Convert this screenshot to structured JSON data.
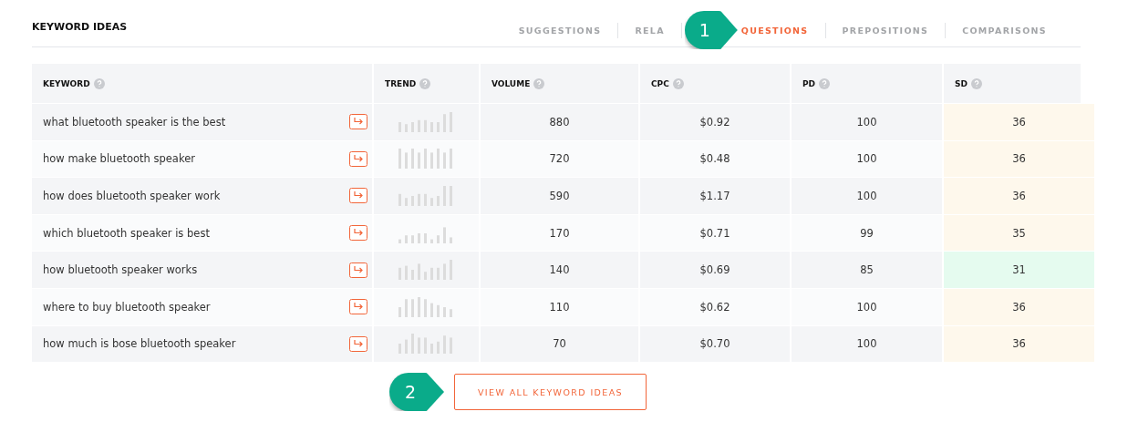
{
  "title": "KEYWORD IDEAS",
  "tabs": [
    {
      "label": "SUGGESTIONS",
      "selected": false
    },
    {
      "label": "RELA",
      "selected": false
    },
    {
      "label": "QUESTIONS",
      "selected": true
    },
    {
      "label": "PREPOSITIONS",
      "selected": false
    },
    {
      "label": "COMPARISONS",
      "selected": false
    }
  ],
  "columns": [
    "KEYWORD",
    "TREND",
    "VOLUME",
    "CPC",
    "PD",
    "SD"
  ],
  "rows": [
    {
      "keyword": "what bluetooth speaker is the best",
      "volume": "880",
      "cpc": "$0.92",
      "pd": "100",
      "sd": "36",
      "color": "#fef8ec"
    },
    {
      "keyword": "how make bluetooth speaker",
      "volume": "720",
      "cpc": "$0.48",
      "pd": "100",
      "sd": "36",
      "color": "#fef8ec"
    },
    {
      "keyword": "how does bluetooth speaker work",
      "volume": "590",
      "cpc": "$1.17",
      "pd": "100",
      "sd": "36",
      "color": "#fef8ec"
    },
    {
      "keyword": "which bluetooth speaker is best",
      "volume": "170",
      "cpc": "$0.71",
      "pd": "99",
      "sd": "35",
      "color": "#fef8ec"
    },
    {
      "keyword": "how bluetooth speaker works",
      "volume": "140",
      "cpc": "$0.69",
      "pd": "85",
      "sd": "31",
      "color": "#e5fbef"
    },
    {
      "keyword": "where to buy bluetooth speaker",
      "volume": "110",
      "cpc": "$0.62",
      "pd": "100",
      "sd": "36",
      "color": "#fef8ec"
    },
    {
      "keyword": "how much is bose bluetooth speaker",
      "volume": "70",
      "cpc": "$0.70",
      "pd": "100",
      "sd": "36",
      "color": "#fef8ec"
    }
  ],
  "button": "VIEW ALL KEYWORD IDEAS",
  "callouts": [
    "1",
    "2"
  ]
}
